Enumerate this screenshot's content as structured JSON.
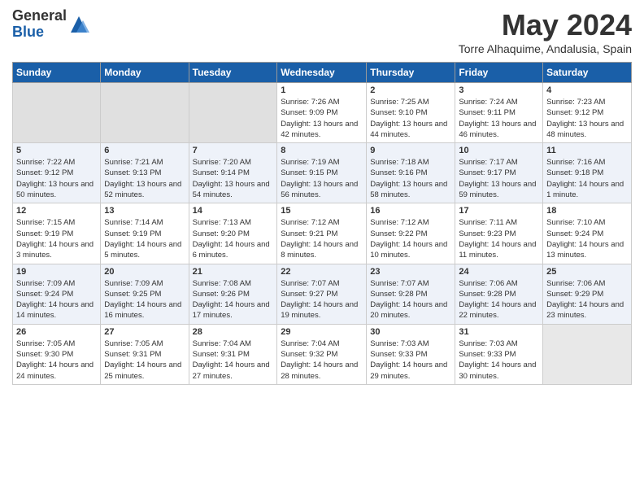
{
  "header": {
    "logo_general": "General",
    "logo_blue": "Blue",
    "title": "May 2024",
    "location": "Torre Alhaquime, Andalusia, Spain"
  },
  "days_of_week": [
    "Sunday",
    "Monday",
    "Tuesday",
    "Wednesday",
    "Thursday",
    "Friday",
    "Saturday"
  ],
  "weeks": [
    [
      {
        "day": "",
        "empty": true
      },
      {
        "day": "",
        "empty": true
      },
      {
        "day": "",
        "empty": true
      },
      {
        "day": "1",
        "sunrise": "7:26 AM",
        "sunset": "9:09 PM",
        "daylight": "13 hours and 42 minutes."
      },
      {
        "day": "2",
        "sunrise": "7:25 AM",
        "sunset": "9:10 PM",
        "daylight": "13 hours and 44 minutes."
      },
      {
        "day": "3",
        "sunrise": "7:24 AM",
        "sunset": "9:11 PM",
        "daylight": "13 hours and 46 minutes."
      },
      {
        "day": "4",
        "sunrise": "7:23 AM",
        "sunset": "9:12 PM",
        "daylight": "13 hours and 48 minutes."
      }
    ],
    [
      {
        "day": "5",
        "sunrise": "7:22 AM",
        "sunset": "9:12 PM",
        "daylight": "13 hours and 50 minutes."
      },
      {
        "day": "6",
        "sunrise": "7:21 AM",
        "sunset": "9:13 PM",
        "daylight": "13 hours and 52 minutes."
      },
      {
        "day": "7",
        "sunrise": "7:20 AM",
        "sunset": "9:14 PM",
        "daylight": "13 hours and 54 minutes."
      },
      {
        "day": "8",
        "sunrise": "7:19 AM",
        "sunset": "9:15 PM",
        "daylight": "13 hours and 56 minutes."
      },
      {
        "day": "9",
        "sunrise": "7:18 AM",
        "sunset": "9:16 PM",
        "daylight": "13 hours and 58 minutes."
      },
      {
        "day": "10",
        "sunrise": "7:17 AM",
        "sunset": "9:17 PM",
        "daylight": "13 hours and 59 minutes."
      },
      {
        "day": "11",
        "sunrise": "7:16 AM",
        "sunset": "9:18 PM",
        "daylight": "14 hours and 1 minute."
      }
    ],
    [
      {
        "day": "12",
        "sunrise": "7:15 AM",
        "sunset": "9:19 PM",
        "daylight": "14 hours and 3 minutes."
      },
      {
        "day": "13",
        "sunrise": "7:14 AM",
        "sunset": "9:19 PM",
        "daylight": "14 hours and 5 minutes."
      },
      {
        "day": "14",
        "sunrise": "7:13 AM",
        "sunset": "9:20 PM",
        "daylight": "14 hours and 6 minutes."
      },
      {
        "day": "15",
        "sunrise": "7:12 AM",
        "sunset": "9:21 PM",
        "daylight": "14 hours and 8 minutes."
      },
      {
        "day": "16",
        "sunrise": "7:12 AM",
        "sunset": "9:22 PM",
        "daylight": "14 hours and 10 minutes."
      },
      {
        "day": "17",
        "sunrise": "7:11 AM",
        "sunset": "9:23 PM",
        "daylight": "14 hours and 11 minutes."
      },
      {
        "day": "18",
        "sunrise": "7:10 AM",
        "sunset": "9:24 PM",
        "daylight": "14 hours and 13 minutes."
      }
    ],
    [
      {
        "day": "19",
        "sunrise": "7:09 AM",
        "sunset": "9:24 PM",
        "daylight": "14 hours and 14 minutes."
      },
      {
        "day": "20",
        "sunrise": "7:09 AM",
        "sunset": "9:25 PM",
        "daylight": "14 hours and 16 minutes."
      },
      {
        "day": "21",
        "sunrise": "7:08 AM",
        "sunset": "9:26 PM",
        "daylight": "14 hours and 17 minutes."
      },
      {
        "day": "22",
        "sunrise": "7:07 AM",
        "sunset": "9:27 PM",
        "daylight": "14 hours and 19 minutes."
      },
      {
        "day": "23",
        "sunrise": "7:07 AM",
        "sunset": "9:28 PM",
        "daylight": "14 hours and 20 minutes."
      },
      {
        "day": "24",
        "sunrise": "7:06 AM",
        "sunset": "9:28 PM",
        "daylight": "14 hours and 22 minutes."
      },
      {
        "day": "25",
        "sunrise": "7:06 AM",
        "sunset": "9:29 PM",
        "daylight": "14 hours and 23 minutes."
      }
    ],
    [
      {
        "day": "26",
        "sunrise": "7:05 AM",
        "sunset": "9:30 PM",
        "daylight": "14 hours and 24 minutes."
      },
      {
        "day": "27",
        "sunrise": "7:05 AM",
        "sunset": "9:31 PM",
        "daylight": "14 hours and 25 minutes."
      },
      {
        "day": "28",
        "sunrise": "7:04 AM",
        "sunset": "9:31 PM",
        "daylight": "14 hours and 27 minutes."
      },
      {
        "day": "29",
        "sunrise": "7:04 AM",
        "sunset": "9:32 PM",
        "daylight": "14 hours and 28 minutes."
      },
      {
        "day": "30",
        "sunrise": "7:03 AM",
        "sunset": "9:33 PM",
        "daylight": "14 hours and 29 minutes."
      },
      {
        "day": "31",
        "sunrise": "7:03 AM",
        "sunset": "9:33 PM",
        "daylight": "14 hours and 30 minutes."
      },
      {
        "day": "",
        "empty": true
      }
    ]
  ],
  "labels": {
    "sunrise_prefix": "Sunrise: ",
    "sunset_prefix": "Sunset: ",
    "daylight_prefix": "Daylight: "
  }
}
